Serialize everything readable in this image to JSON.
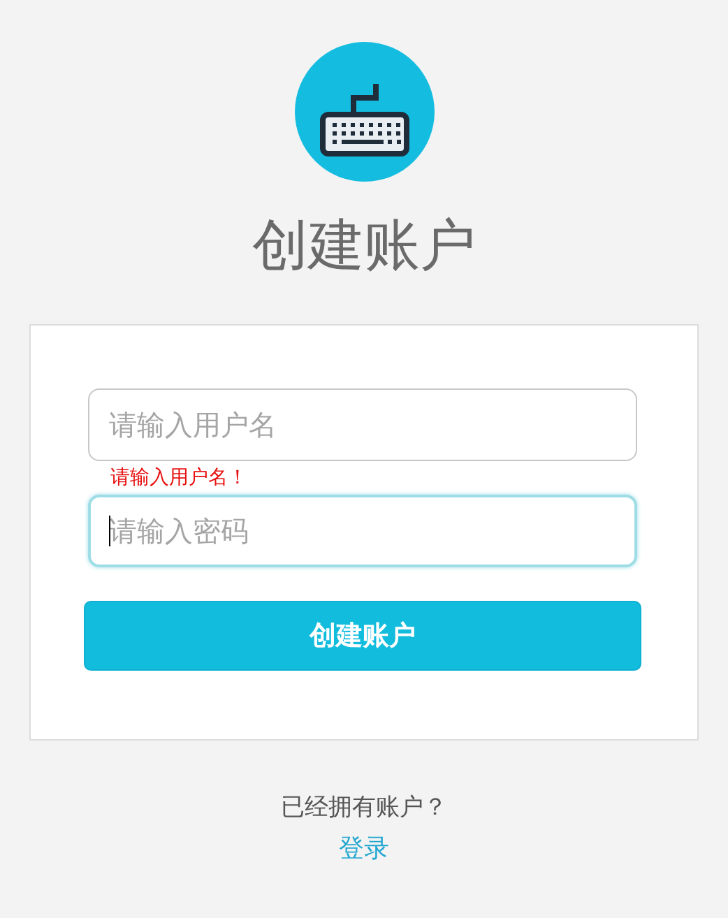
{
  "title": "创建账户",
  "fields": [
    {
      "placeholder": "请输入用户名",
      "focused": false,
      "error": "请输入用户名！"
    },
    {
      "placeholder": "请输入密码",
      "focused": true
    }
  ],
  "submit_button": "创建账户",
  "footer": {
    "text": "已经拥有账户？",
    "link": "登录"
  }
}
